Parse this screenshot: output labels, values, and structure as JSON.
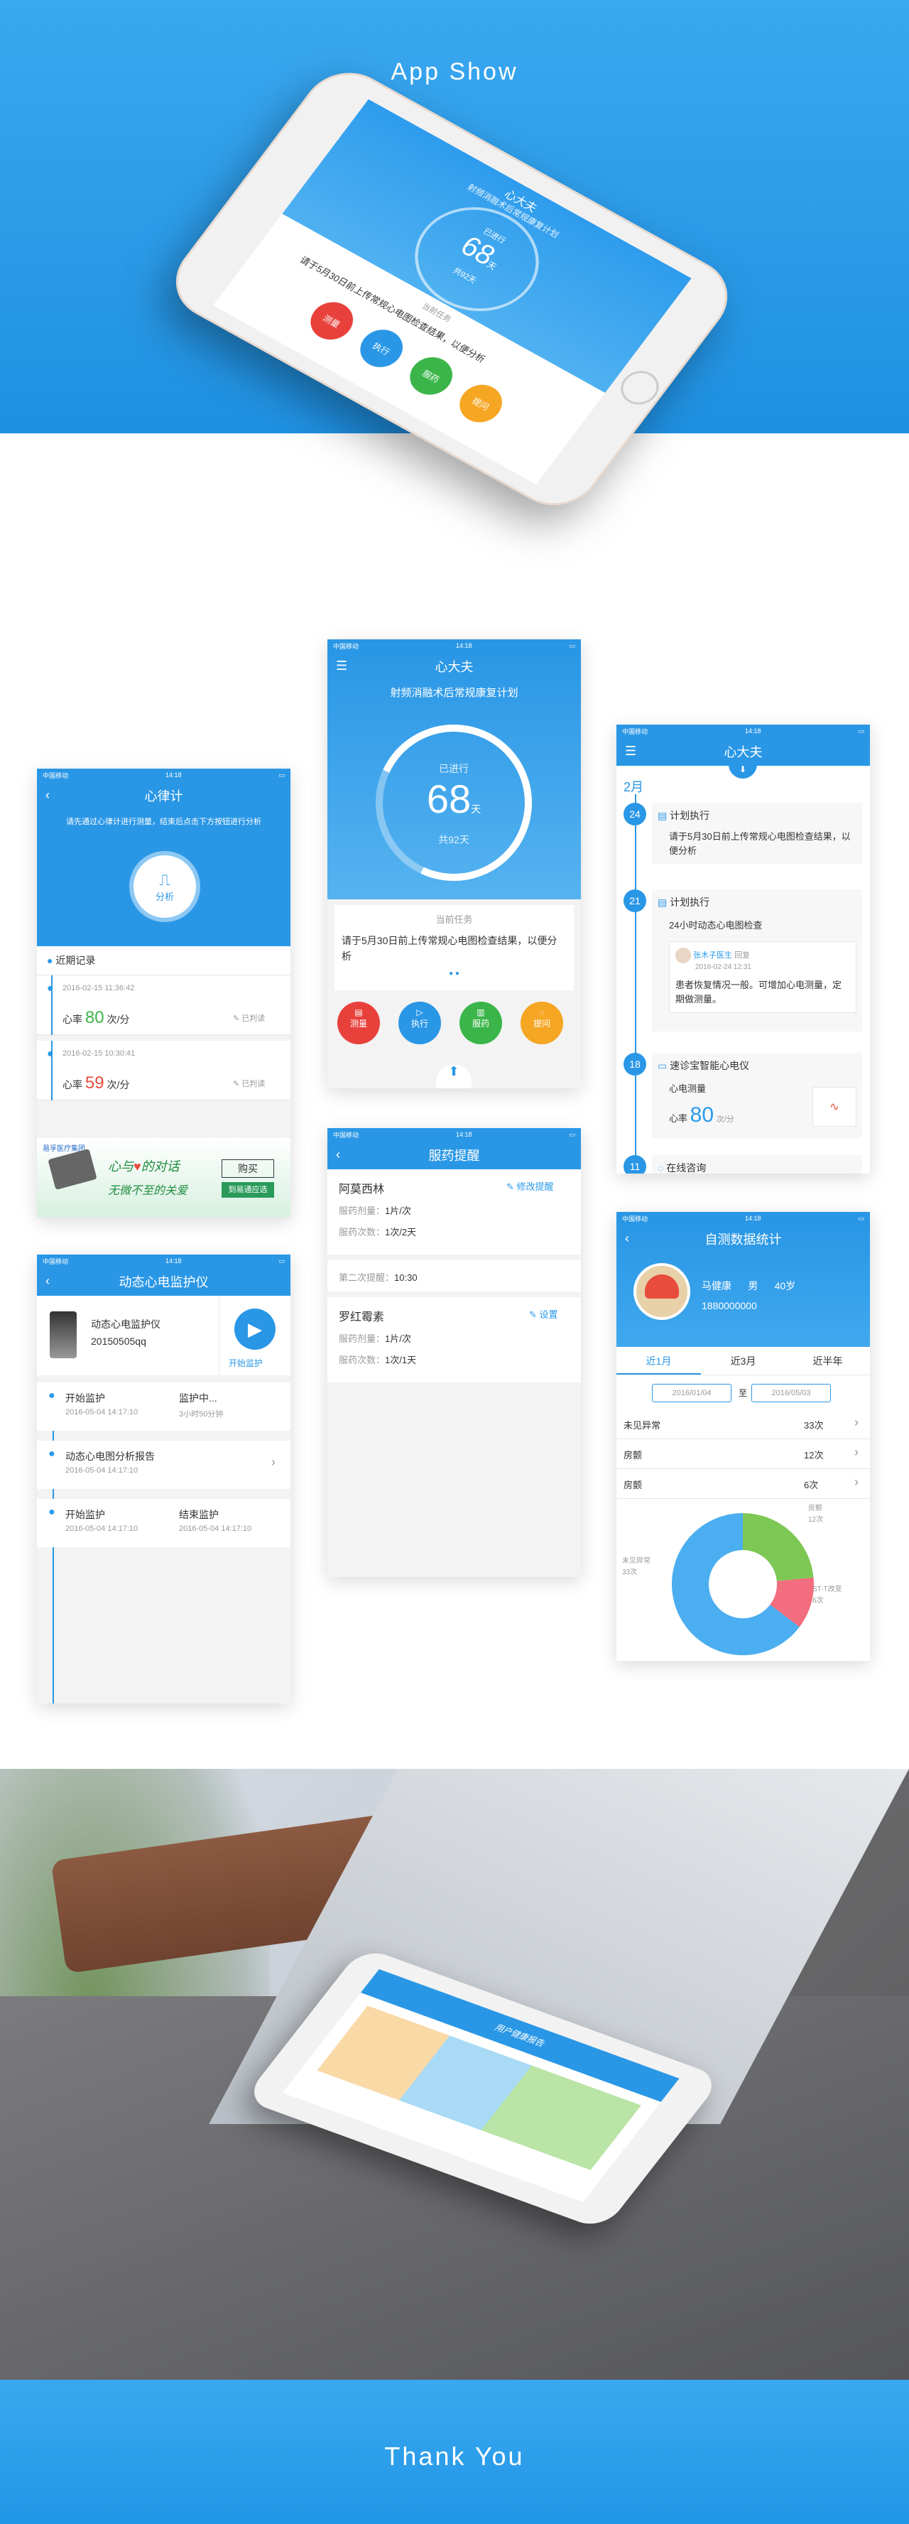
{
  "hero": {
    "title": "App Show"
  },
  "footer": {
    "title": "Thank You"
  },
  "hero_phone": {
    "app_title": "心大夫",
    "plan": "射频消融术后常规康复计划",
    "progress_label": "已进行",
    "days": "68",
    "unit": "天",
    "total": "共92天",
    "task_label": "当前任务",
    "task_text": "请于5月30日前上传常规心电图检查结果，以便分析",
    "buttons": [
      "测量",
      "执行",
      "服药",
      "提问"
    ]
  },
  "status": {
    "carrier": "中国移动",
    "time": "14:18"
  },
  "rhythm": {
    "title": "心律计",
    "hint": "请先通过心律计进行测量，结束后点击下方按钮进行分析",
    "analyze": "分析",
    "recent": "近期记录",
    "records": [
      {
        "time": "2016-02-15  11:36:42",
        "label": "心率",
        "value": "80",
        "unit": "次/分",
        "status": "已判读",
        "color": "#3bb54a"
      },
      {
        "time": "2016-02-15  10:30:41",
        "label": "心率",
        "value": "59",
        "unit": "次/分",
        "status": "已判读",
        "color": "#e74c3c"
      }
    ],
    "banner_brand": "易孚医疗集团",
    "banner_line1": "心与",
    "banner_line2": "的对话",
    "banner_line3": "无微不至的关爱",
    "banner_buy": "购买",
    "banner_shop": "到易通应选"
  },
  "main": {
    "title": "心大夫",
    "plan": "射频消融术后常规康复计划",
    "progress_label": "已进行",
    "days": "68",
    "unit": "天",
    "total": "共92天",
    "task_label": "当前任务",
    "task_text": "请于5月30日前上传常规心电图检查结果，以便分析",
    "buttons": [
      {
        "label": "测量",
        "color": "#e8413c"
      },
      {
        "label": "执行",
        "color": "#2a97e6"
      },
      {
        "label": "服药",
        "color": "#3bb54a"
      },
      {
        "label": "提问",
        "color": "#f5a623"
      }
    ]
  },
  "timeline": {
    "title": "心大夫",
    "month": "2月",
    "items": [
      {
        "day": "24",
        "title": "计划执行",
        "text": "请于5月30日前上传常规心电图检查结果，以便分析"
      },
      {
        "day": "21",
        "title": "计划执行",
        "text": "24小时动态心电图检查",
        "doctor": "张木子医生",
        "doctor_note": "回复",
        "doctor_time": "2016-02-24  12:31",
        "reply": "患者恢复情况一般。可增加心电测量，定期做测量。"
      },
      {
        "day": "18",
        "title": "速诊宝智能心电仪",
        "text": "心电测量",
        "hr_label": "心率",
        "hr_value": "80",
        "hr_unit": "次/分"
      },
      {
        "day": "11",
        "title": "在线咨询",
        "text": ""
      }
    ]
  },
  "ecg_monitor": {
    "title": "动态心电监护仪",
    "device_name": "动态心电监护仪",
    "device_id": "20150505qq",
    "start": "开始监护",
    "rows": [
      {
        "a_title": "开始监护",
        "a_time": "2016-05-04  14:17:10",
        "b_title": "监护中...",
        "b_time": "3小时50分钟"
      },
      {
        "a_title": "动态心电图分析报告",
        "a_time": "2016-05-04  14:17:10",
        "b_title": "",
        "b_time": ""
      },
      {
        "a_title": "开始监护",
        "a_time": "2016-05-04  14:17:10",
        "b_title": "结束监护",
        "b_time": "2016-05-04  14:17:10"
      }
    ]
  },
  "medication": {
    "title": "服药提醒",
    "drugs": [
      {
        "name": "阿莫西林",
        "action": "修改提醒",
        "dose_label": "服药剂量：",
        "dose": "1片/次",
        "freq_label": "服药次数：",
        "freq": "1次/2天"
      },
      {
        "name": "罗红霉素",
        "action": "设置",
        "dose_label": "服药剂量：",
        "dose": "1片/次",
        "freq_label": "服药次数：",
        "freq": "1次/1天"
      }
    ],
    "second_label": "第二次提醒：",
    "second_time": "10:30"
  },
  "stats": {
    "title": "自测数据统计",
    "name": "马健康",
    "gender": "男",
    "age": "40岁",
    "phone": "1880000000",
    "tabs": [
      "近1月",
      "近3月",
      "近半年"
    ],
    "date_from": "2016/01/04",
    "date_sep": "至",
    "date_to": "2016/05/03",
    "rows": [
      {
        "label": "未见异常",
        "value": "33次"
      },
      {
        "label": "房颤",
        "value": "12次"
      },
      {
        "label": "房颤",
        "value": "6次"
      }
    ],
    "pie": {
      "segments": [
        {
          "name": "未见异常",
          "count": "33次",
          "value": 33,
          "color": "#4aaef0"
        },
        {
          "name": "房颤",
          "count": "12次",
          "value": 12,
          "color": "#7dc855"
        },
        {
          "name": "ST-T改变",
          "count": "6次",
          "value": 6,
          "color": "#f26d7d"
        }
      ]
    }
  },
  "photo_phone": {
    "title": "用户健康报告"
  }
}
